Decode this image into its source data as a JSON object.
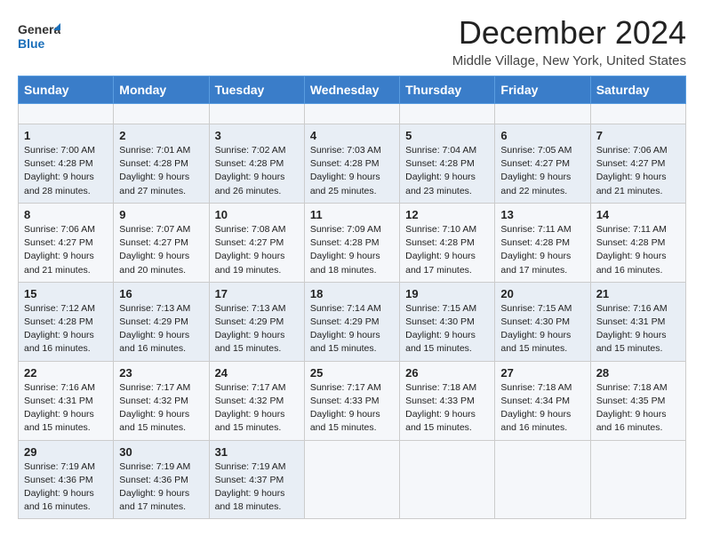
{
  "header": {
    "logo_line1": "General",
    "logo_line2": "Blue",
    "title": "December 2024",
    "subtitle": "Middle Village, New York, United States"
  },
  "calendar": {
    "days_of_week": [
      "Sunday",
      "Monday",
      "Tuesday",
      "Wednesday",
      "Thursday",
      "Friday",
      "Saturday"
    ],
    "weeks": [
      [
        {
          "day": "",
          "empty": true
        },
        {
          "day": "",
          "empty": true
        },
        {
          "day": "",
          "empty": true
        },
        {
          "day": "",
          "empty": true
        },
        {
          "day": "",
          "empty": true
        },
        {
          "day": "",
          "empty": true
        },
        {
          "day": "",
          "empty": true
        }
      ],
      [
        {
          "day": "1",
          "sunrise": "7:00 AM",
          "sunset": "4:28 PM",
          "daylight": "9 hours and 28 minutes."
        },
        {
          "day": "2",
          "sunrise": "7:01 AM",
          "sunset": "4:28 PM",
          "daylight": "9 hours and 27 minutes."
        },
        {
          "day": "3",
          "sunrise": "7:02 AM",
          "sunset": "4:28 PM",
          "daylight": "9 hours and 26 minutes."
        },
        {
          "day": "4",
          "sunrise": "7:03 AM",
          "sunset": "4:28 PM",
          "daylight": "9 hours and 25 minutes."
        },
        {
          "day": "5",
          "sunrise": "7:04 AM",
          "sunset": "4:28 PM",
          "daylight": "9 hours and 23 minutes."
        },
        {
          "day": "6",
          "sunrise": "7:05 AM",
          "sunset": "4:27 PM",
          "daylight": "9 hours and 22 minutes."
        },
        {
          "day": "7",
          "sunrise": "7:06 AM",
          "sunset": "4:27 PM",
          "daylight": "9 hours and 21 minutes."
        }
      ],
      [
        {
          "day": "8",
          "sunrise": "7:06 AM",
          "sunset": "4:27 PM",
          "daylight": "9 hours and 21 minutes."
        },
        {
          "day": "9",
          "sunrise": "7:07 AM",
          "sunset": "4:27 PM",
          "daylight": "9 hours and 20 minutes."
        },
        {
          "day": "10",
          "sunrise": "7:08 AM",
          "sunset": "4:27 PM",
          "daylight": "9 hours and 19 minutes."
        },
        {
          "day": "11",
          "sunrise": "7:09 AM",
          "sunset": "4:28 PM",
          "daylight": "9 hours and 18 minutes."
        },
        {
          "day": "12",
          "sunrise": "7:10 AM",
          "sunset": "4:28 PM",
          "daylight": "9 hours and 17 minutes."
        },
        {
          "day": "13",
          "sunrise": "7:11 AM",
          "sunset": "4:28 PM",
          "daylight": "9 hours and 17 minutes."
        },
        {
          "day": "14",
          "sunrise": "7:11 AM",
          "sunset": "4:28 PM",
          "daylight": "9 hours and 16 minutes."
        }
      ],
      [
        {
          "day": "15",
          "sunrise": "7:12 AM",
          "sunset": "4:28 PM",
          "daylight": "9 hours and 16 minutes."
        },
        {
          "day": "16",
          "sunrise": "7:13 AM",
          "sunset": "4:29 PM",
          "daylight": "9 hours and 16 minutes."
        },
        {
          "day": "17",
          "sunrise": "7:13 AM",
          "sunset": "4:29 PM",
          "daylight": "9 hours and 15 minutes."
        },
        {
          "day": "18",
          "sunrise": "7:14 AM",
          "sunset": "4:29 PM",
          "daylight": "9 hours and 15 minutes."
        },
        {
          "day": "19",
          "sunrise": "7:15 AM",
          "sunset": "4:30 PM",
          "daylight": "9 hours and 15 minutes."
        },
        {
          "day": "20",
          "sunrise": "7:15 AM",
          "sunset": "4:30 PM",
          "daylight": "9 hours and 15 minutes."
        },
        {
          "day": "21",
          "sunrise": "7:16 AM",
          "sunset": "4:31 PM",
          "daylight": "9 hours and 15 minutes."
        }
      ],
      [
        {
          "day": "22",
          "sunrise": "7:16 AM",
          "sunset": "4:31 PM",
          "daylight": "9 hours and 15 minutes."
        },
        {
          "day": "23",
          "sunrise": "7:17 AM",
          "sunset": "4:32 PM",
          "daylight": "9 hours and 15 minutes."
        },
        {
          "day": "24",
          "sunrise": "7:17 AM",
          "sunset": "4:32 PM",
          "daylight": "9 hours and 15 minutes."
        },
        {
          "day": "25",
          "sunrise": "7:17 AM",
          "sunset": "4:33 PM",
          "daylight": "9 hours and 15 minutes."
        },
        {
          "day": "26",
          "sunrise": "7:18 AM",
          "sunset": "4:33 PM",
          "daylight": "9 hours and 15 minutes."
        },
        {
          "day": "27",
          "sunrise": "7:18 AM",
          "sunset": "4:34 PM",
          "daylight": "9 hours and 16 minutes."
        },
        {
          "day": "28",
          "sunrise": "7:18 AM",
          "sunset": "4:35 PM",
          "daylight": "9 hours and 16 minutes."
        }
      ],
      [
        {
          "day": "29",
          "sunrise": "7:19 AM",
          "sunset": "4:36 PM",
          "daylight": "9 hours and 16 minutes."
        },
        {
          "day": "30",
          "sunrise": "7:19 AM",
          "sunset": "4:36 PM",
          "daylight": "9 hours and 17 minutes."
        },
        {
          "day": "31",
          "sunrise": "7:19 AM",
          "sunset": "4:37 PM",
          "daylight": "9 hours and 18 minutes."
        },
        {
          "day": "",
          "empty": true
        },
        {
          "day": "",
          "empty": true
        },
        {
          "day": "",
          "empty": true
        },
        {
          "day": "",
          "empty": true
        }
      ]
    ],
    "labels": {
      "sunrise": "Sunrise:",
      "sunset": "Sunset:",
      "daylight": "Daylight:"
    }
  }
}
